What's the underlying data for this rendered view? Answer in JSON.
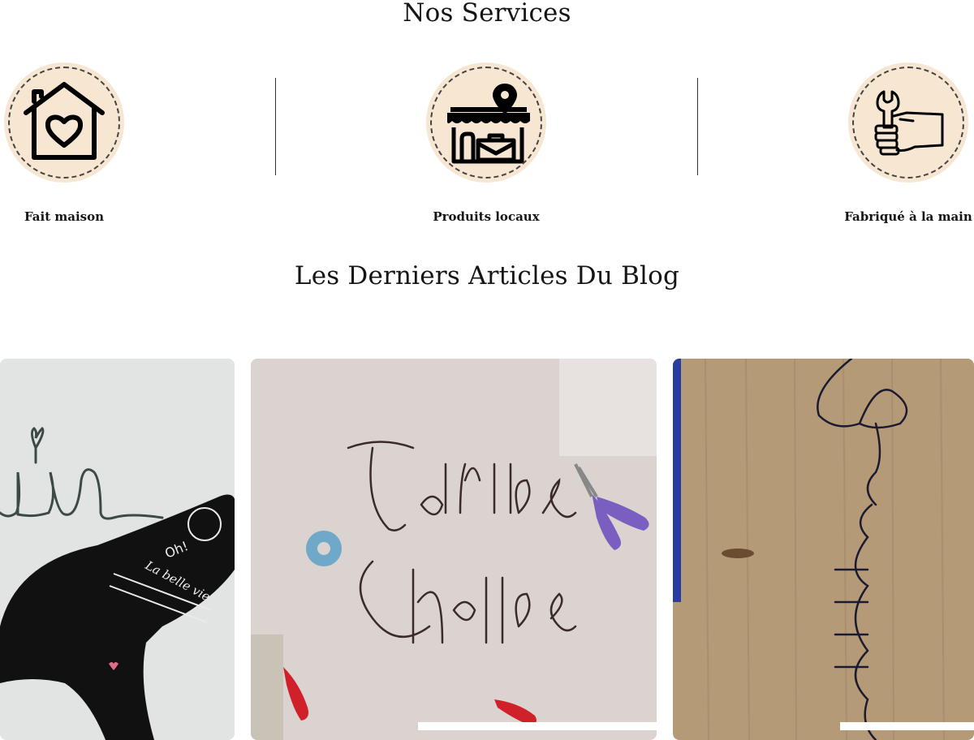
{
  "services": {
    "title": "Nos Services",
    "items": [
      {
        "label": "Fait maison",
        "icon": "house-heart-icon"
      },
      {
        "label": "Produits locaux",
        "icon": "local-shop-icon"
      },
      {
        "label": "Fabriqué à la main",
        "icon": "hand-wrench-icon"
      }
    ]
  },
  "blog": {
    "title": "Les Derniers Articles Du Blog",
    "articles": [
      {
        "image": "rocket-wire-art-image",
        "image_text": [
          "Oh!",
          "La belle vie"
        ]
      },
      {
        "image": "toilettes-chiottes-wire-art-image",
        "image_text": [
          "Toilettes",
          "Chiottes"
        ]
      },
      {
        "image": "maitresse-wire-art-image",
        "image_text": [
          "Maîtresse"
        ]
      }
    ]
  },
  "colors": {
    "icon_circle": "#f7e6d2",
    "dash": "#444444",
    "text": "#151515"
  }
}
